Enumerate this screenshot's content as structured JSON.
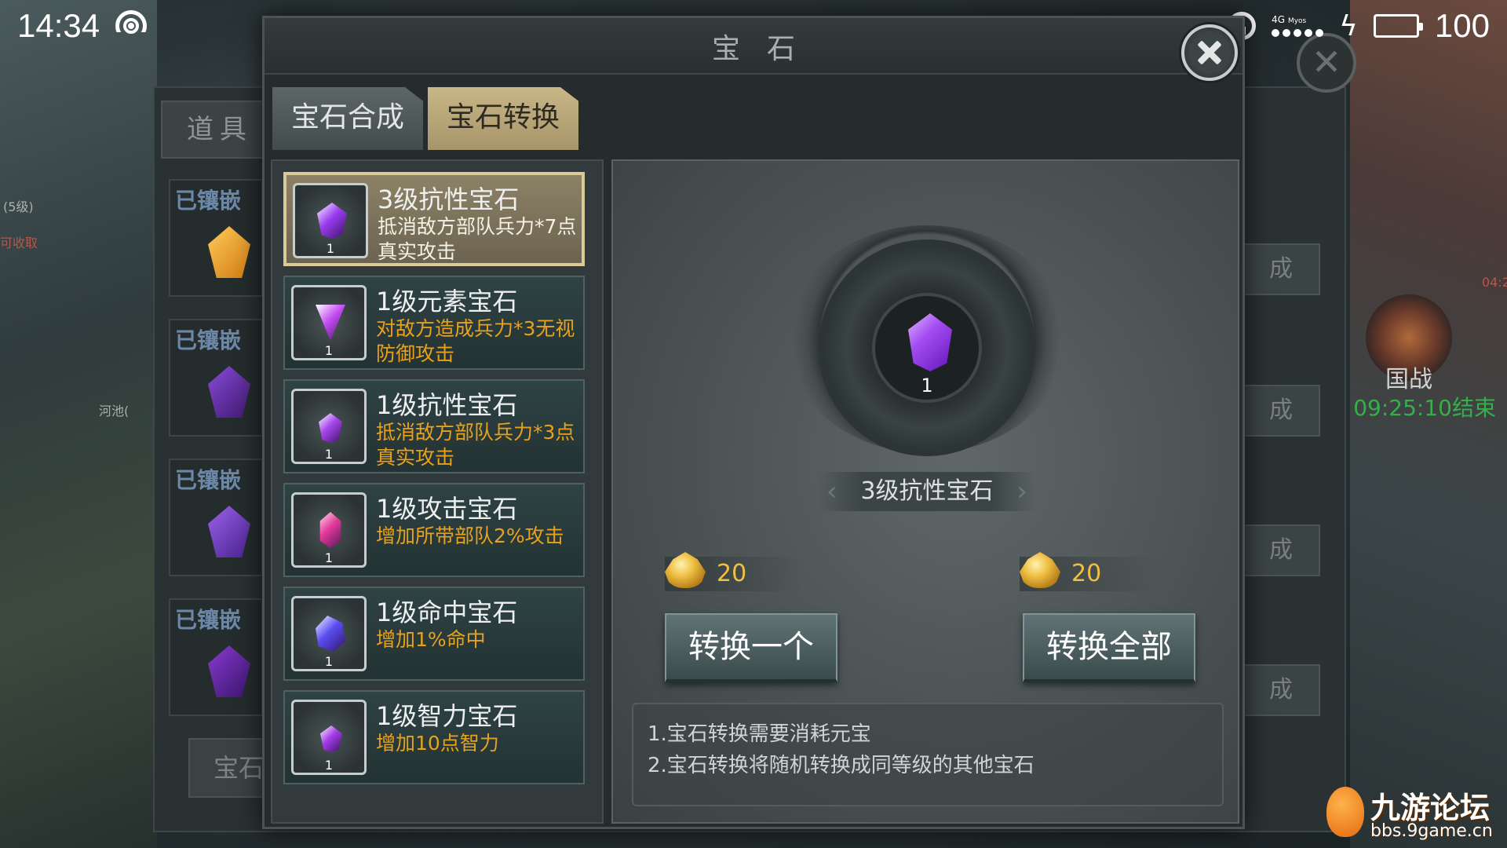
{
  "status_bar": {
    "time": "14:34",
    "network_type": "4G",
    "network_sub": "Myos",
    "battery_level": 100,
    "battery_text": "100"
  },
  "background": {
    "items_tab_label": "道具",
    "slot_label": "已镶嵌",
    "synth_label": "成",
    "bottom_button_label": "宝石",
    "map_labels": [
      "(5级)",
      "可收取",
      "河池(",
      "04:2"
    ],
    "nation_war_label": "国战",
    "nation_war_time": "09:25:10结束"
  },
  "dialog": {
    "title": "宝石",
    "tabs": [
      {
        "label": "宝石合成",
        "active": false
      },
      {
        "label": "宝石转换",
        "active": true
      }
    ],
    "gems": [
      {
        "name": "3级抗性宝石",
        "desc": "抵消敌方部队兵力*7点真实攻击",
        "count": "1",
        "color": "#9a3cf0",
        "selected": true
      },
      {
        "name": "1级元素宝石",
        "desc": "对敌方造成兵力*3无视防御攻击",
        "count": "1",
        "color": "#c34bf2",
        "selected": false
      },
      {
        "name": "1级抗性宝石",
        "desc": "抵消敌方部队兵力*3点真实攻击",
        "count": "1",
        "color": "#a845ee",
        "selected": false
      },
      {
        "name": "1级攻击宝石",
        "desc": "增加所带部队2%攻击",
        "count": "1",
        "color": "#e43a9a",
        "selected": false
      },
      {
        "name": "1级命中宝石",
        "desc": "增加1%命中",
        "count": "1",
        "color": "#5a4ef4",
        "selected": false
      },
      {
        "name": "1级智力宝石",
        "desc": "增加10点智力",
        "count": "1",
        "color": "#a43de8",
        "selected": false
      }
    ],
    "detail": {
      "selected_gem_name": "3级抗性宝石",
      "selected_gem_count": "1",
      "cost_one": "20",
      "cost_all": "20",
      "convert_one_label": "转换一个",
      "convert_all_label": "转换全部",
      "notes": [
        "1.宝石转换需要消耗元宝",
        "2.宝石转换将随机转换成同等级的其他宝石"
      ]
    }
  },
  "watermark": {
    "title": "九游论坛",
    "url": "bbs.9game.cn"
  }
}
